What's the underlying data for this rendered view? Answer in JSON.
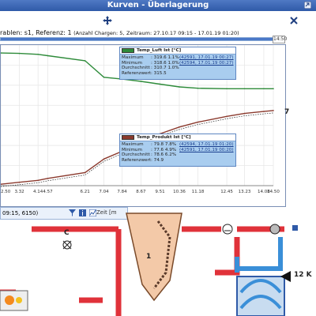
{
  "window": {
    "title": "Kurven - Überlagerung"
  },
  "info": {
    "prefix": "rablen: s1,  Referenz: 1",
    "charges": "(Anzahl Chargen: 5,",
    "zeitraum": "Zeitraum: 27.10.17 09:15 - 17.01.19 01:20)",
    "time_field": "14:50"
  },
  "colors": {
    "green": "#2e8b3a",
    "brown": "#8b3a2e",
    "legend_bg": "#a9cdef",
    "pipe_red": "#e0323a",
    "pipe_blue": "#3a8fd8",
    "title_bar": "#2f5aa8"
  },
  "legend1": {
    "name": "Temp_Luft Ist [°C]",
    "rows": [
      {
        "key": "Maximum",
        "value": ": 319.6  1.1%",
        "link": "(42591, 17.01.19 00:27)"
      },
      {
        "key": "Minimum",
        "value": ": 318.6  1.0%",
        "link": "(42594, 17.01.19 00:27)"
      },
      {
        "key": "Durchschnitt",
        "value": ": 310.7  1.0%",
        "link": ""
      },
      {
        "key": "Referenzwert",
        "value": ": 315.5",
        "link": ""
      }
    ]
  },
  "legend2": {
    "name": "Temp_Produkt Ist [°C]",
    "rows": [
      {
        "key": "Maximum",
        "value": ": 79.8  7.8%",
        "link": "(42594, 17.01.19 01:20)"
      },
      {
        "key": "Minimum",
        "value": ": 77.6  4.9%",
        "link": "(42591, 17.01.19 00:20)"
      },
      {
        "key": "Durchschnitt",
        "value": ": 78.6  6.2%",
        "link": ""
      },
      {
        "key": "Referenzwert",
        "value": ": 74.9",
        "link": ""
      }
    ]
  },
  "axis": {
    "x_ticks": [
      "2.50",
      "3.32",
      "4.14",
      "4.57",
      "6.21",
      "7.04",
      "7.84",
      "8.67",
      "9.51",
      "10.36",
      "11.18",
      "12.45",
      "13.23",
      "14.08",
      "14.50"
    ],
    "zeit_label": "Zeit [m"
  },
  "chart_data": {
    "type": "line",
    "x": [
      2.5,
      3.32,
      4.14,
      4.57,
      6.21,
      7.04,
      7.84,
      8.67,
      9.51,
      10.36,
      11.18,
      12.45,
      13.23,
      14.08,
      14.5
    ],
    "xlabel": "Zeit [m",
    "series": [
      {
        "name": "Temp_Luft Ist [°C]",
        "values": [
          319.3,
          319.2,
          319.0,
          318.7,
          317.6,
          314.0,
          313.6,
          313.1,
          312.5,
          311.9,
          311.6,
          311.5,
          311.5,
          311.5,
          311.5
        ]
      },
      {
        "name": "Temp_Produkt Ist [°C]",
        "values": [
          40.0,
          41.0,
          42.0,
          43.0,
          46.0,
          53.0,
          57.0,
          62.0,
          66.0,
          69.5,
          72.0,
          75.0,
          76.5,
          77.5,
          78.0
        ]
      }
    ]
  },
  "bottom": {
    "date": "09:15, 6150)"
  },
  "process": {
    "label_c": "C",
    "label_1": "1",
    "label_7": "7",
    "label_12k": "12 K"
  }
}
